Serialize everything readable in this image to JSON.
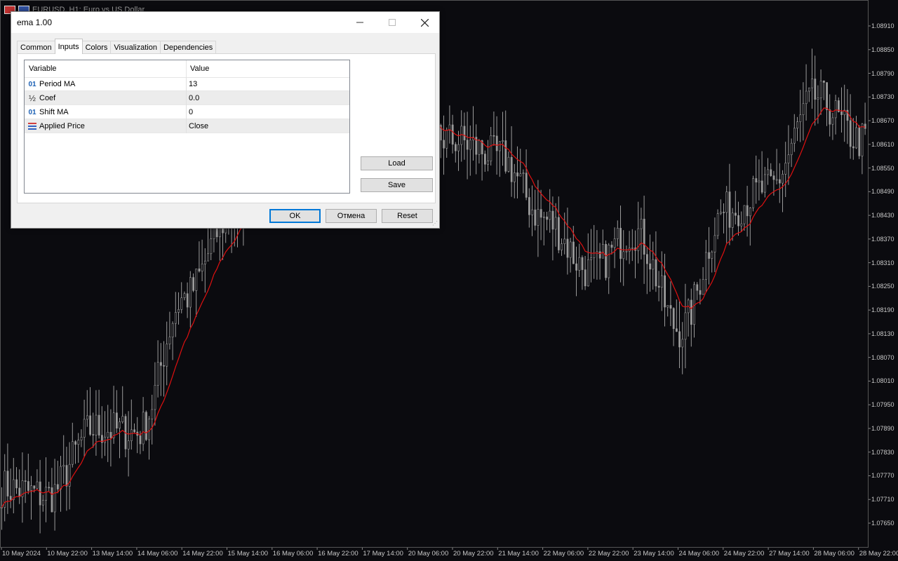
{
  "chart": {
    "window_title": "EURUSD, H1:  Euro vs US Dollar",
    "prices": [
      "1.08910",
      "1.08850",
      "1.08790",
      "1.08730",
      "1.08670",
      "1.08610",
      "1.08550",
      "1.08490",
      "1.08430",
      "1.08370",
      "1.08310",
      "1.08250",
      "1.08190",
      "1.08130",
      "1.08070",
      "1.08010",
      "1.07950",
      "1.07890",
      "1.07830",
      "1.07770",
      "1.07710",
      "1.07650"
    ],
    "times": [
      "10 May 2024",
      "10 May 22:00",
      "13 May 14:00",
      "14 May 06:00",
      "14 May 22:00",
      "15 May 14:00",
      "16 May 06:00",
      "16 May 22:00",
      "17 May 14:00",
      "20 May 06:00",
      "20 May 22:00",
      "21 May 14:00",
      "22 May 06:00",
      "22 May 22:00",
      "23 May 14:00",
      "24 May 06:00",
      "24 May 22:00",
      "27 May 14:00",
      "28 May 06:00",
      "28 May 22:00"
    ],
    "candle_color": "#9a9a9a",
    "ema_color": "#e01010",
    "background": "#0b0b0f"
  },
  "chart_data": {
    "type": "line",
    "symbol": "EURUSD",
    "timeframe": "H1",
    "ylim": [
      1.0762,
      1.0895
    ],
    "x": [
      "10 May 2024",
      "10 May 22:00",
      "13 May 14:00",
      "14 May 06:00",
      "14 May 22:00",
      "15 May 14:00",
      "16 May 06:00",
      "16 May 22:00",
      "17 May 14:00",
      "20 May 06:00",
      "20 May 22:00",
      "21 May 14:00",
      "22 May 06:00",
      "22 May 22:00",
      "23 May 14:00",
      "24 May 06:00",
      "24 May 22:00",
      "27 May 14:00",
      "28 May 06:00",
      "28 May 22:00"
    ],
    "series": [
      {
        "values": [
          1.0774,
          1.0772,
          1.0789,
          1.0788,
          1.0822,
          1.0842,
          1.0862,
          1.0856,
          1.0855,
          1.0866,
          1.0862,
          1.0858,
          1.0842,
          1.0829,
          1.0839,
          1.0814,
          1.0844,
          1.085,
          1.0873,
          1.0862
        ]
      }
    ]
  },
  "dialog": {
    "title": "ema 1.00",
    "tabs": [
      "Common",
      "Inputs",
      "Colors",
      "Visualization",
      "Dependencies"
    ],
    "columns": {
      "variable": "Variable",
      "value": "Value"
    },
    "rows": [
      {
        "icon": "01",
        "name": "Period MA",
        "value": "13"
      },
      {
        "icon": "½",
        "name": "Coef",
        "value": "0.0"
      },
      {
        "icon": "01",
        "name": "Shift MA",
        "value": "0"
      },
      {
        "icon": "list",
        "name": "Applied Price",
        "value": "Close"
      }
    ],
    "load": "Load",
    "save": "Save",
    "ok": "OK",
    "cancel": "Отмена",
    "reset": "Reset"
  }
}
